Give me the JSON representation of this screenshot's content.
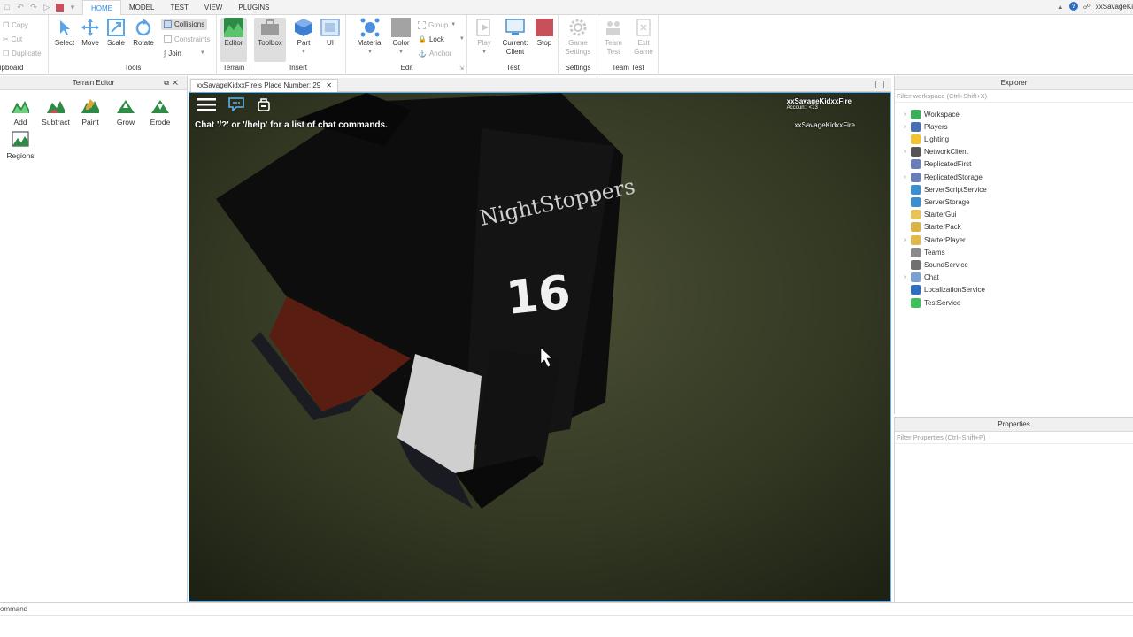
{
  "window": {
    "menu_tabs": [
      "HOME",
      "MODEL",
      "TEST",
      "VIEW",
      "PLUGINS"
    ],
    "active_tab": "HOME",
    "username": "xxSavageKi"
  },
  "ribbon": {
    "clipboard": {
      "copy": "Copy",
      "cut": "Cut",
      "duplicate": "Duplicate",
      "label": "lipboard"
    },
    "tools": {
      "select": "Select",
      "move": "Move",
      "scale": "Scale",
      "rotate": "Rotate",
      "collisions": "Collisions",
      "constraints": "Constraints",
      "join": "Join",
      "label": "Tools"
    },
    "terrain": {
      "editor": "Editor",
      "label": "Terrain"
    },
    "insert": {
      "toolbox": "Toolbox",
      "part": "Part",
      "ui": "UI",
      "label": "Insert"
    },
    "edit": {
      "material": "Material",
      "color": "Color",
      "group": "Group",
      "lock": "Lock",
      "anchor": "Anchor",
      "label": "Edit"
    },
    "test": {
      "play": "Play",
      "current_client_1": "Current:",
      "current_client_2": "Client",
      "stop": "Stop",
      "label": "Test"
    },
    "settings": {
      "game_settings_1": "Game",
      "game_settings_2": "Settings",
      "label": "Settings"
    },
    "team_test": {
      "team_test_1": "Team",
      "team_test_2": "Test",
      "exit_game_1": "Exit",
      "exit_game_2": "Game",
      "label": "Team Test"
    }
  },
  "terrain_editor": {
    "title": "Terrain Editor",
    "tools": [
      "Add",
      "Subtract",
      "Paint",
      "Grow",
      "Erode",
      "Regions"
    ]
  },
  "viewport": {
    "tab_title": "xxSavageKidxxFire's Place Number: 29",
    "chat_hint": "Chat '/?' or '/help' for a list of chat commands.",
    "player_name": "xxSavageKidxxFire",
    "account": "Account: <13",
    "player_list_entry": "xxSavageKidxxFire",
    "shirt_text": "NightStoppers",
    "shirt_number": "16"
  },
  "explorer": {
    "title": "Explorer",
    "filter_placeholder": "Filter workspace (Ctrl+Shift+X)",
    "items": [
      {
        "name": "Workspace",
        "expandable": true,
        "color": "#3fae5a"
      },
      {
        "name": "Players",
        "expandable": true,
        "color": "#4a6fb5"
      },
      {
        "name": "Lighting",
        "expandable": false,
        "color": "#f2c230"
      },
      {
        "name": "NetworkClient",
        "expandable": true,
        "color": "#555555"
      },
      {
        "name": "ReplicatedFirst",
        "expandable": false,
        "color": "#6a7fb8"
      },
      {
        "name": "ReplicatedStorage",
        "expandable": true,
        "color": "#6a7fb8"
      },
      {
        "name": "ServerScriptService",
        "expandable": false,
        "color": "#3b8fcf"
      },
      {
        "name": "ServerStorage",
        "expandable": false,
        "color": "#3b8fcf"
      },
      {
        "name": "StarterGui",
        "expandable": false,
        "color": "#e8c35a"
      },
      {
        "name": "StarterPack",
        "expandable": false,
        "color": "#d9b24a"
      },
      {
        "name": "StarterPlayer",
        "expandable": true,
        "color": "#e0b84c"
      },
      {
        "name": "Teams",
        "expandable": false,
        "color": "#8a8a8a"
      },
      {
        "name": "SoundService",
        "expandable": false,
        "color": "#707070"
      },
      {
        "name": "Chat",
        "expandable": true,
        "color": "#7aa0d0"
      },
      {
        "name": "LocalizationService",
        "expandable": false,
        "color": "#2f6fc2"
      },
      {
        "name": "TestService",
        "expandable": false,
        "color": "#3fbf5a"
      }
    ]
  },
  "properties": {
    "title": "Properties",
    "filter_placeholder": "Filter Properties (Ctrl+Shift+P)"
  },
  "command_bar": {
    "placeholder": "ommand"
  },
  "colors": {
    "accent": "#2f8de4",
    "viewport_border": "#58b4f5",
    "stop_red": "#c8505b"
  }
}
